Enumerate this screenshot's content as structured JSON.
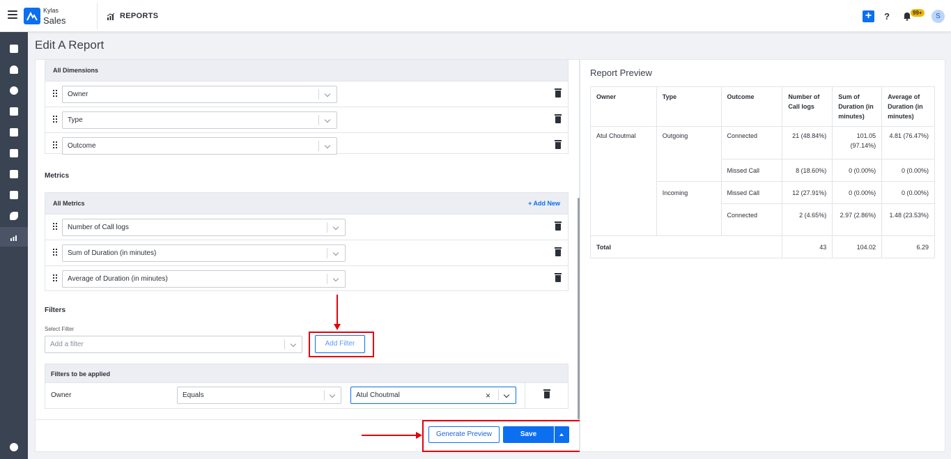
{
  "brand": {
    "line1": "Kylas",
    "line2": "Sales"
  },
  "header": {
    "section": "REPORTS",
    "help": "?",
    "notif_count": "99+",
    "avatar_initial": "S",
    "add": "+"
  },
  "colors": {
    "accent": "#0b6ff0",
    "sidebar": "#394352",
    "highlight": "#e3000b"
  },
  "page": {
    "title": "Edit A Report"
  },
  "dimensions": {
    "header": "All Dimensions",
    "items": [
      {
        "value": "Owner"
      },
      {
        "value": "Type"
      },
      {
        "value": "Outcome"
      }
    ]
  },
  "metrics": {
    "section_label": "Metrics",
    "header": "All Metrics",
    "add_new": "+ Add New",
    "items": [
      {
        "value": "Number of Call logs"
      },
      {
        "value": "Sum of Duration (in minutes)"
      },
      {
        "value": "Average of Duration (in minutes)"
      }
    ]
  },
  "filters": {
    "section_label": "Filters",
    "select_label": "Select Filter",
    "select_placeholder": "Add a filter",
    "add_button": "Add Filter",
    "applied_header": "Filters to be applied",
    "applied": [
      {
        "field": "Owner",
        "operator": "Equals",
        "value": "Atul Choutmal",
        "clear": "×"
      }
    ]
  },
  "actions": {
    "generate_preview": "Generate Preview",
    "save": "Save"
  },
  "preview": {
    "title": "Report Preview",
    "columns": [
      "Owner",
      "Type",
      "Outcome",
      "Number of Call logs",
      "Sum of Duration (in minutes)",
      "Average of Duration (in minutes)"
    ],
    "owner": "Atul Choutmal",
    "types": [
      {
        "type": "Outgoing",
        "rows": [
          {
            "outcome": "Connected",
            "count": "21 (48.84%)",
            "sum": "101.05 (97.14%)",
            "avg": "4.81 (76.47%)"
          },
          {
            "outcome": "Missed Call",
            "count": "8 (18.60%)",
            "sum": "0 (0.00%)",
            "avg": "0 (0.00%)"
          }
        ]
      },
      {
        "type": "Incoming",
        "rows": [
          {
            "outcome": "Missed Call",
            "count": "12 (27.91%)",
            "sum": "0 (0.00%)",
            "avg": "0 (0.00%)"
          },
          {
            "outcome": "Connected",
            "count": "2 (4.65%)",
            "sum": "2.97 (2.86%)",
            "avg": "1.48 (23.53%)"
          }
        ]
      }
    ],
    "total": {
      "label": "Total",
      "count": "43",
      "sum": "104.02",
      "avg": "6.29"
    }
  }
}
